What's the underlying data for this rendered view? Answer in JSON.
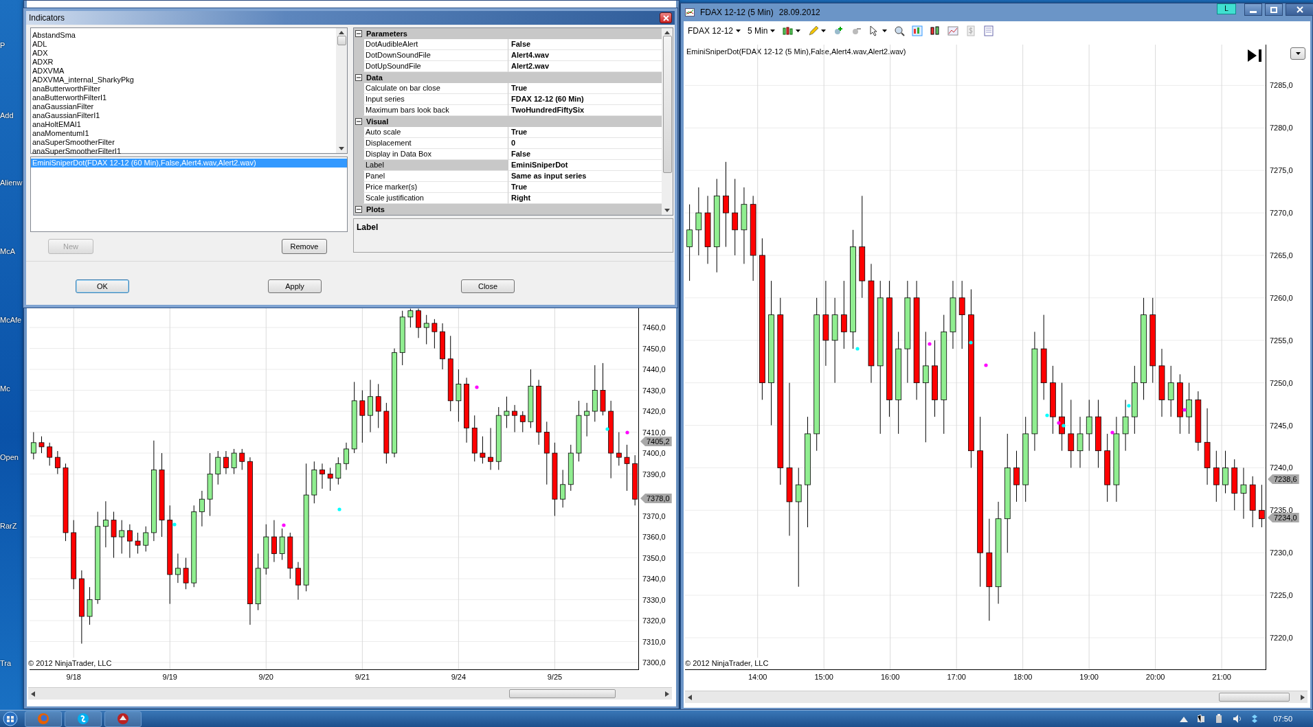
{
  "desktop_icons": [
    {
      "label": "P"
    },
    {
      "label": "Add"
    },
    {
      "label": "Alienw"
    },
    {
      "label": "McA"
    },
    {
      "label": "McAfe"
    },
    {
      "label": "Mc"
    },
    {
      "label": "Open"
    },
    {
      "label": "RarZ"
    },
    {
      "label": "Tra"
    }
  ],
  "indicators_dialog": {
    "title": "Indicators",
    "available": [
      "AbstandSma",
      "ADL",
      "ADX",
      "ADXR",
      "ADXVMA",
      "ADXVMA_internal_SharkyPkg",
      "anaButterworthFilter",
      "anaButterworthFilterI1",
      "anaGaussianFilter",
      "anaGaussianFilterI1",
      "anaHoltEMAI1",
      "anaMomentumI1",
      "anaSuperSmootherFilter",
      "anaSuperSmootherFilterI1"
    ],
    "applied": [
      {
        "label": "EminiSniperDot(FDAX 12-12 (60 Min),False,Alert4.wav,Alert2.wav)",
        "selected": true
      }
    ],
    "list_buttons": [
      {
        "label": "New",
        "disabled": true
      },
      {
        "label": "Remove",
        "disabled": false
      }
    ],
    "properties": [
      {
        "category": "Parameters",
        "expanded": true,
        "rows": [
          {
            "name": "DotAudibleAlert",
            "value": "False",
            "selected": false
          },
          {
            "name": "DotDownSoundFile",
            "value": "Alert4.wav",
            "selected": false
          },
          {
            "name": "DotUpSoundFile",
            "value": "Alert2.wav",
            "selected": false
          }
        ]
      },
      {
        "category": "Data",
        "expanded": true,
        "rows": [
          {
            "name": "Calculate on bar close",
            "value": "True",
            "selected": false
          },
          {
            "name": "Input series",
            "value": "FDAX 12-12 (60 Min)",
            "selected": false
          },
          {
            "name": "Maximum bars look back",
            "value": "TwoHundredFiftySix",
            "selected": false
          }
        ]
      },
      {
        "category": "Visual",
        "expanded": true,
        "rows": [
          {
            "name": "Auto scale",
            "value": "True",
            "selected": false
          },
          {
            "name": "Displacement",
            "value": "0",
            "selected": false
          },
          {
            "name": "Display in Data Box",
            "value": "False",
            "selected": false
          },
          {
            "name": "Label",
            "value": "EminiSniperDot",
            "selected": true
          },
          {
            "name": "Panel",
            "value": "Same as input series",
            "selected": false
          },
          {
            "name": "Price marker(s)",
            "value": "True",
            "selected": false
          },
          {
            "name": "Scale justification",
            "value": "Right",
            "selected": false
          }
        ]
      },
      {
        "category": "Plots",
        "expanded": true
      }
    ],
    "description": {
      "title": "Label"
    },
    "footer_buttons": [
      {
        "label": "OK",
        "default": true
      },
      {
        "label": "Apply",
        "default": false
      },
      {
        "label": "Close",
        "default": false
      }
    ]
  },
  "left_chart": {
    "chart_data": {
      "type": "candlestick",
      "categories": [
        null,
        null,
        null,
        null,
        null,
        "9/18",
        null,
        null,
        null,
        null,
        null,
        null,
        null,
        null,
        null,
        null,
        null,
        "9/19",
        null,
        null,
        null,
        null,
        null,
        null,
        null,
        null,
        null,
        null,
        null,
        "9/20",
        null,
        null,
        null,
        null,
        null,
        null,
        null,
        null,
        null,
        null,
        null,
        "9/21",
        null,
        null,
        null,
        null,
        null,
        null,
        null,
        null,
        null,
        null,
        null,
        "9/24",
        null,
        null,
        null,
        null,
        null,
        null,
        null,
        null,
        null,
        null,
        null,
        "9/25",
        null,
        null,
        null,
        null,
        null,
        null,
        null,
        null,
        null,
        null
      ],
      "ohlc": [
        [
          7400,
          7410,
          7397,
          7405
        ],
        [
          7405,
          7408,
          7400,
          7403
        ],
        [
          7403,
          7405,
          7394,
          7398
        ],
        [
          7398,
          7401,
          7390,
          7393
        ],
        [
          7393,
          7395,
          7358,
          7362
        ],
        [
          7362,
          7368,
          7335,
          7340
        ],
        [
          7340,
          7344,
          7309,
          7322
        ],
        [
          7322,
          7336,
          7318,
          7330
        ],
        [
          7330,
          7372,
          7328,
          7365
        ],
        [
          7365,
          7377,
          7355,
          7368
        ],
        [
          7368,
          7372,
          7350,
          7360
        ],
        [
          7360,
          7368,
          7352,
          7363
        ],
        [
          7363,
          7366,
          7350,
          7358
        ],
        [
          7358,
          7362,
          7352,
          7356
        ],
        [
          7356,
          7365,
          7353,
          7362
        ],
        [
          7362,
          7406,
          7358,
          7392
        ],
        [
          7392,
          7400,
          7360,
          7368
        ],
        [
          7368,
          7375,
          7328,
          7342
        ],
        [
          7342,
          7352,
          7338,
          7345
        ],
        [
          7345,
          7350,
          7335,
          7338
        ],
        [
          7338,
          7375,
          7336,
          7372
        ],
        [
          7372,
          7382,
          7365,
          7378
        ],
        [
          7378,
          7400,
          7370,
          7390
        ],
        [
          7390,
          7401,
          7385,
          7398
        ],
        [
          7398,
          7401,
          7390,
          7393
        ],
        [
          7393,
          7402,
          7390,
          7400
        ],
        [
          7400,
          7402,
          7392,
          7396
        ],
        [
          7396,
          7398,
          7318,
          7328
        ],
        [
          7328,
          7352,
          7325,
          7345
        ],
        [
          7345,
          7366,
          7342,
          7360
        ],
        [
          7360,
          7368,
          7348,
          7352
        ],
        [
          7352,
          7364,
          7349,
          7360
        ],
        [
          7360,
          7362,
          7340,
          7345
        ],
        [
          7345,
          7348,
          7330,
          7337
        ],
        [
          7337,
          7395,
          7334,
          7380
        ],
        [
          7380,
          7396,
          7376,
          7392
        ],
        [
          7392,
          7395,
          7383,
          7390
        ],
        [
          7390,
          7393,
          7382,
          7388
        ],
        [
          7388,
          7398,
          7385,
          7395
        ],
        [
          7395,
          7405,
          7392,
          7402
        ],
        [
          7402,
          7434,
          7400,
          7425
        ],
        [
          7425,
          7430,
          7405,
          7418
        ],
        [
          7418,
          7435,
          7410,
          7427
        ],
        [
          7427,
          7433,
          7412,
          7420
        ],
        [
          7420,
          7424,
          7395,
          7400
        ],
        [
          7400,
          7450,
          7398,
          7448
        ],
        [
          7448,
          7468,
          7442,
          7465
        ],
        [
          7465,
          7469,
          7460,
          7468
        ],
        [
          7468,
          7469,
          7455,
          7460
        ],
        [
          7460,
          7466,
          7452,
          7462
        ],
        [
          7462,
          7464,
          7450,
          7458
        ],
        [
          7458,
          7462,
          7440,
          7445
        ],
        [
          7445,
          7456,
          7420,
          7425
        ],
        [
          7425,
          7440,
          7415,
          7433
        ],
        [
          7433,
          7436,
          7405,
          7412
        ],
        [
          7412,
          7418,
          7396,
          7400
        ],
        [
          7400,
          7408,
          7395,
          7398
        ],
        [
          7398,
          7412,
          7392,
          7396
        ],
        [
          7396,
          7422,
          7392,
          7418
        ],
        [
          7418,
          7427,
          7412,
          7420
        ],
        [
          7420,
          7423,
          7410,
          7418
        ],
        [
          7418,
          7420,
          7410,
          7415
        ],
        [
          7415,
          7440,
          7412,
          7432
        ],
        [
          7432,
          7435,
          7404,
          7410
        ],
        [
          7410,
          7415,
          7385,
          7400
        ],
        [
          7400,
          7405,
          7370,
          7378
        ],
        [
          7378,
          7392,
          7374,
          7385
        ],
        [
          7385,
          7404,
          7382,
          7400
        ],
        [
          7400,
          7425,
          7396,
          7418
        ],
        [
          7418,
          7424,
          7408,
          7420
        ],
        [
          7420,
          7442,
          7415,
          7430
        ],
        [
          7430,
          7443,
          7418,
          7420
        ],
        [
          7420,
          7425,
          7388,
          7400
        ],
        [
          7400,
          7410,
          7394,
          7398
        ],
        [
          7398,
          7404,
          7382,
          7395
        ],
        [
          7395,
          7399,
          7375,
          7378
        ]
      ],
      "ylim": [
        7296.4,
        7469.2
      ],
      "grid": true,
      "yticks": [
        {
          "value": 7460,
          "label": "7460,0"
        },
        {
          "value": 7450,
          "label": "7450,0"
        },
        {
          "value": 7440,
          "label": "7440,0"
        },
        {
          "value": 7430,
          "label": "7430,0"
        },
        {
          "value": 7420,
          "label": "7420,0"
        },
        {
          "value": 7410,
          "label": "7410,0"
        },
        {
          "value": 7400,
          "label": "7400,0"
        },
        {
          "value": 7390,
          "label": "7390,0"
        },
        {
          "value": 7370,
          "label": "7370,0"
        },
        {
          "value": 7360,
          "label": "7360,0"
        },
        {
          "value": 7350,
          "label": "7350,0"
        },
        {
          "value": 7340,
          "label": "7340,0"
        },
        {
          "value": 7330,
          "label": "7330,0"
        },
        {
          "value": 7320,
          "label": "7320,0"
        },
        {
          "value": 7310,
          "label": "7310,0"
        },
        {
          "value": 7300,
          "label": "7300,0"
        }
      ]
    },
    "signal_dots": [
      {
        "color": "#00ffff"
      },
      {
        "color": "#ff00ff"
      },
      {
        "color": "#00ffff"
      },
      {
        "color": "#ff00ff"
      },
      {
        "color": "#00ffff"
      },
      {
        "color": "#ff00ff"
      }
    ],
    "price_markers": [
      "7405,2",
      "7378,0"
    ],
    "copyright": "© 2012 NinjaTrader, LLC"
  },
  "right_chart": {
    "title": "FDAX 12-12 (5 Min)",
    "date": "28.09.2012",
    "badge": "L",
    "toolbar": {
      "instrument": "FDAX 12-12",
      "interval": "5 Min"
    },
    "indicator_label": "EminiSniperDot(FDAX 12-12 (5 Min),False,Alert4.wav,Alert2.wav)",
    "chart_data": {
      "type": "candlestick",
      "x": [
        12.973,
        13.11,
        13.247,
        13.384,
        13.521,
        13.658,
        13.795,
        13.932,
        14.069,
        14.206,
        14.343,
        14.48,
        14.617,
        14.754,
        14.891,
        15.028,
        15.165,
        15.302,
        15.439,
        15.576,
        15.713,
        15.85,
        15.987,
        16.124,
        16.261,
        16.398,
        16.535,
        16.672,
        16.809,
        16.946,
        17.083,
        17.22,
        17.357,
        17.494,
        17.631,
        17.768,
        17.905,
        18.042,
        18.179,
        18.316,
        18.453,
        18.59,
        18.727,
        18.864,
        19.001,
        19.138,
        19.275,
        19.412,
        19.549,
        19.686,
        19.823,
        19.96,
        20.097,
        20.234,
        20.371,
        20.508,
        20.645,
        20.782,
        20.919,
        21.056,
        21.193,
        21.33,
        21.467,
        21.604
      ],
      "ohlc": [
        [
          7266,
          7271,
          7262,
          7268
        ],
        [
          7268,
          7273,
          7265,
          7270
        ],
        [
          7270,
          7272,
          7264,
          7266
        ],
        [
          7266,
          7274,
          7263,
          7272
        ],
        [
          7272,
          7276,
          7266,
          7270
        ],
        [
          7270,
          7274,
          7265,
          7268
        ],
        [
          7268,
          7273,
          7264,
          7271
        ],
        [
          7271,
          7272,
          7262,
          7265
        ],
        [
          7265,
          7267,
          7248,
          7250
        ],
        [
          7250,
          7262,
          7245,
          7258
        ],
        [
          7258,
          7260,
          7238,
          7240
        ],
        [
          7240,
          7250,
          7232,
          7236
        ],
        [
          7236,
          7240,
          7226,
          7238
        ],
        [
          7238,
          7246,
          7233,
          7244
        ],
        [
          7244,
          7260,
          7242,
          7258
        ],
        [
          7258,
          7262,
          7252,
          7255
        ],
        [
          7255,
          7260,
          7250,
          7258
        ],
        [
          7258,
          7262,
          7254,
          7256
        ],
        [
          7256,
          7268,
          7254,
          7266
        ],
        [
          7266,
          7272,
          7260,
          7262
        ],
        [
          7262,
          7264,
          7250,
          7252
        ],
        [
          7252,
          7262,
          7244,
          7260
        ],
        [
          7260,
          7262,
          7246,
          7248
        ],
        [
          7248,
          7256,
          7244,
          7254
        ],
        [
          7254,
          7262,
          7250,
          7260
        ],
        [
          7260,
          7262,
          7248,
          7250
        ],
        [
          7250,
          7256,
          7243,
          7252
        ],
        [
          7252,
          7255,
          7246,
          7248
        ],
        [
          7248,
          7258,
          7244,
          7256
        ],
        [
          7256,
          7262,
          7254,
          7260
        ],
        [
          7260,
          7262,
          7254,
          7258
        ],
        [
          7258,
          7261,
          7240,
          7242
        ],
        [
          7242,
          7246,
          7226,
          7230
        ],
        [
          7230,
          7234,
          7222,
          7226
        ],
        [
          7226,
          7236,
          7224,
          7234
        ],
        [
          7234,
          7244,
          7230,
          7240
        ],
        [
          7240,
          7242,
          7236,
          7238
        ],
        [
          7238,
          7246,
          7236,
          7244
        ],
        [
          7244,
          7256,
          7242,
          7254
        ],
        [
          7254,
          7258,
          7248,
          7250
        ],
        [
          7250,
          7252,
          7244,
          7246
        ],
        [
          7246,
          7250,
          7242,
          7244
        ],
        [
          7244,
          7248,
          7240,
          7242
        ],
        [
          7242,
          7246,
          7240,
          7244
        ],
        [
          7244,
          7248,
          7242,
          7246
        ],
        [
          7246,
          7248,
          7240,
          7242
        ],
        [
          7242,
          7244,
          7236,
          7238
        ],
        [
          7238,
          7246,
          7236,
          7244
        ],
        [
          7244,
          7248,
          7242,
          7246
        ],
        [
          7246,
          7252,
          7244,
          7250
        ],
        [
          7250,
          7260,
          7248,
          7258
        ],
        [
          7258,
          7260,
          7250,
          7252
        ],
        [
          7252,
          7254,
          7246,
          7248
        ],
        [
          7248,
          7252,
          7246,
          7250
        ],
        [
          7250,
          7251,
          7244,
          7246
        ],
        [
          7246,
          7250,
          7244,
          7248
        ],
        [
          7248,
          7249,
          7242,
          7243
        ],
        [
          7243,
          7247,
          7238,
          7240
        ],
        [
          7240,
          7242,
          7236,
          7238
        ],
        [
          7238,
          7242,
          7237,
          7240
        ],
        [
          7240,
          7241,
          7235,
          7237
        ],
        [
          7237,
          7240,
          7234,
          7238
        ],
        [
          7238,
          7239,
          7233,
          7235
        ],
        [
          7235,
          7238,
          7233,
          7234
        ]
      ],
      "xlim": [
        12.9045,
        21.6725
      ],
      "ylim": [
        7216.2,
        7289.8
      ],
      "grid": true,
      "xticks": [
        {
          "value": 14,
          "label": "14:00"
        },
        {
          "value": 15,
          "label": "15:00"
        },
        {
          "value": 16,
          "label": "16:00"
        },
        {
          "value": 17,
          "label": "17:00"
        },
        {
          "value": 18,
          "label": "18:00"
        },
        {
          "value": 19,
          "label": "19:00"
        },
        {
          "value": 20,
          "label": "20:00"
        },
        {
          "value": 21,
          "label": "21:00"
        }
      ],
      "yticks": [
        {
          "value": 7285,
          "label": "7285,0"
        },
        {
          "value": 7280,
          "label": "7280,0"
        },
        {
          "value": 7275,
          "label": "7275,0"
        },
        {
          "value": 7270,
          "label": "7270,0"
        },
        {
          "value": 7265,
          "label": "7265,0"
        },
        {
          "value": 7260,
          "label": "7260,0"
        },
        {
          "value": 7255,
          "label": "7255,0"
        },
        {
          "value": 7250,
          "label": "7250,0"
        },
        {
          "value": 7245,
          "label": "7245,0"
        },
        {
          "value": 7240,
          "label": "7240,0"
        },
        {
          "value": 7235,
          "label": "7235,0"
        },
        {
          "value": 7230,
          "label": "7230,0"
        },
        {
          "value": 7225,
          "label": "7225,0"
        },
        {
          "value": 7220,
          "label": "7220,0"
        }
      ]
    },
    "signal_dots": [
      {
        "color": "#00ffff"
      },
      {
        "color": "#ff00ff"
      },
      {
        "color": "#00ffff"
      },
      {
        "color": "#ff00ff"
      },
      {
        "color": "#00ffff"
      },
      {
        "color": "#ff00ff"
      },
      {
        "color": "#00ffff"
      },
      {
        "color": "#ff00ff"
      },
      {
        "color": "#00ffff"
      },
      {
        "color": "#ff00ff"
      }
    ],
    "price_markers": [
      "7238,6",
      "7234,0"
    ],
    "copyright": "© 2012 NinjaTrader, LLC"
  },
  "taskbar": {
    "clock": "07:50"
  }
}
